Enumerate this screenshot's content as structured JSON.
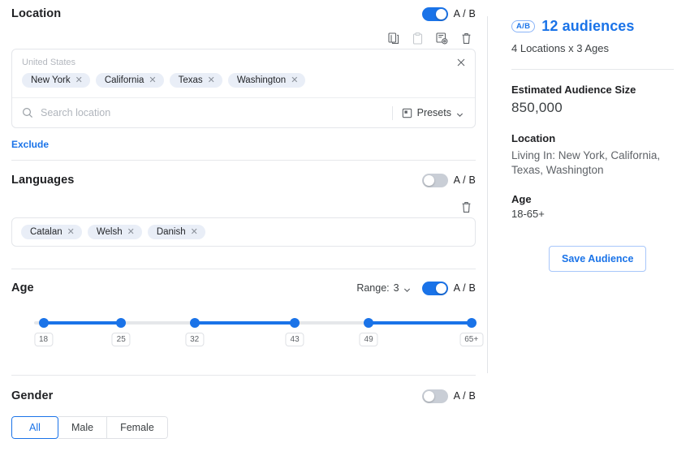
{
  "theme": {
    "accent": "#1a73e8",
    "chip_bg": "#e9eef7",
    "border": "#e4e6ea",
    "muted": "#5f6368"
  },
  "left": {
    "location": {
      "title": "Location",
      "ab_label": "A / B",
      "toggle_state": "on",
      "actions": [
        {
          "name": "copy-icon",
          "title": "Copy"
        },
        {
          "name": "paste-icon",
          "title": "Paste"
        },
        {
          "name": "paste-settings-icon",
          "title": "Paste settings"
        },
        {
          "name": "delete-icon",
          "title": "Delete"
        }
      ],
      "country": "United States",
      "chips": [
        "New York",
        "California",
        "Texas",
        "Washington"
      ],
      "search_placeholder": "Search location",
      "search_value": "",
      "presets_label": "Presets",
      "exclude_label": "Exclude"
    },
    "languages": {
      "title": "Languages",
      "ab_label": "A / B",
      "toggle_state": "off",
      "actions": [
        {
          "name": "delete-icon",
          "title": "Delete"
        }
      ],
      "chips": [
        "Catalan",
        "Welsh",
        "Danish"
      ]
    },
    "age": {
      "title": "Age",
      "ab_label": "A / B",
      "toggle_state": "on",
      "range_prefix": "Range:",
      "range_count": "3",
      "handles": [
        {
          "label": "18",
          "pos": 2.2
        },
        {
          "label": "25",
          "pos": 20.5
        },
        {
          "label": "32",
          "pos": 37.8
        },
        {
          "label": "43",
          "pos": 61.4
        },
        {
          "label": "49",
          "pos": 78.8
        },
        {
          "label": "65+",
          "pos": 103.0
        }
      ],
      "segments": [
        {
          "from": 2.2,
          "to": 20.5
        },
        {
          "from": 37.8,
          "to": 61.4
        },
        {
          "from": 78.8,
          "to": 103.0
        }
      ]
    },
    "gender": {
      "title": "Gender",
      "ab_label": "A / B",
      "toggle_state": "off",
      "options": [
        "All",
        "Male",
        "Female"
      ],
      "selected": "All"
    }
  },
  "right": {
    "badge": "A/B",
    "audiences_count": "12 audiences",
    "breakdown": "4 Locations  x  3 Ages",
    "size_label": "Estimated Audience Size",
    "size_value": "850,000",
    "location_label": "Location",
    "location_value": "Living In: New York, California, Texas, Washington",
    "age_label": "Age",
    "age_value": "18-65+",
    "save_label": "Save Audience"
  }
}
